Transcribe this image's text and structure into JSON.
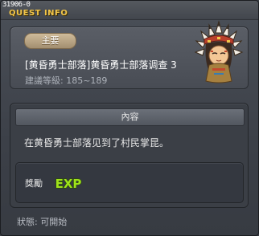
{
  "window": {
    "quest_id": "31906-0",
    "title": "QUEST INFO"
  },
  "quest": {
    "badge": "主要",
    "name": "[黄昏勇士部落]黄昏勇士部落调查 3",
    "level": "建議等級: 185~189"
  },
  "content": {
    "header": "內容",
    "text": "在黄昏勇士部落见到了村民掌昆。"
  },
  "reward": {
    "label": "獎勵",
    "icon": "exp-icon",
    "icon_text": "EXP"
  },
  "status": {
    "text": "狀態: 可開始"
  },
  "colors": {
    "title": "#f2c64a",
    "badge": "#bfa985",
    "exp_fill": "#9fe21b"
  }
}
